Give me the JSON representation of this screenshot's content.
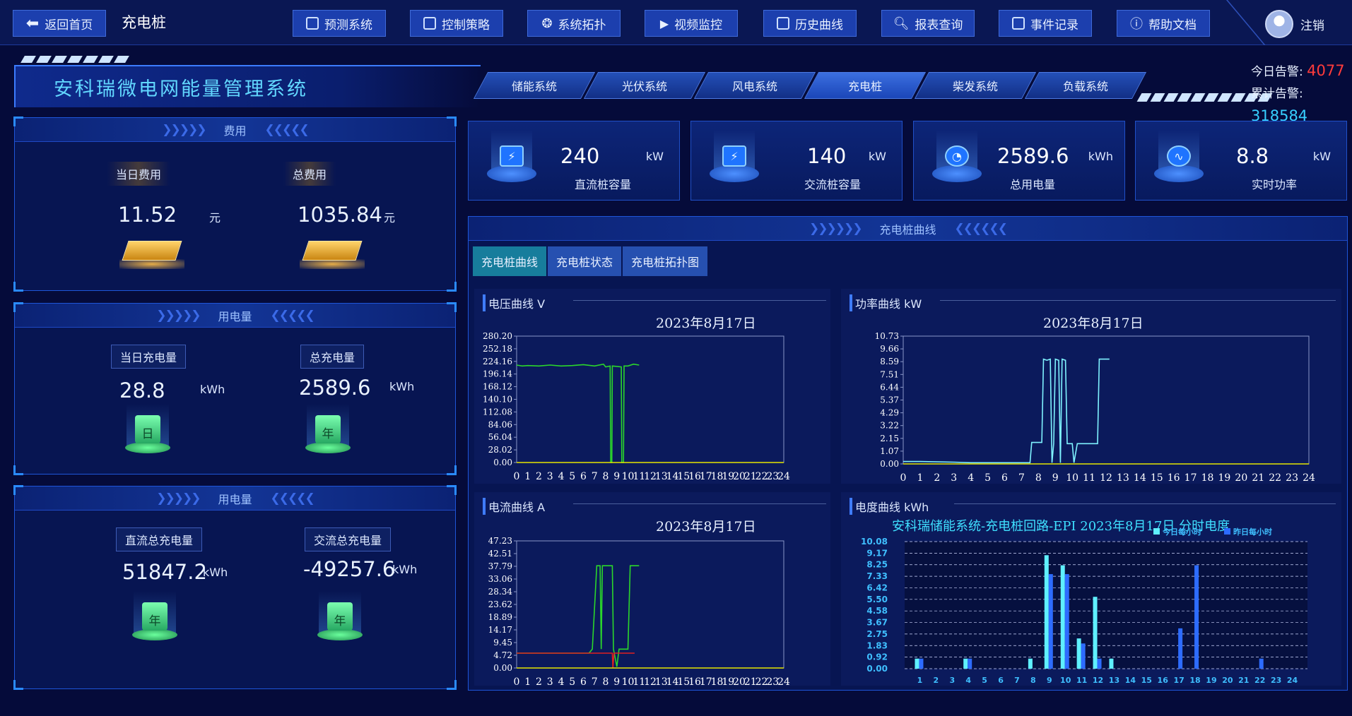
{
  "nav": {
    "back_label": "返回首页",
    "title": "充电桩",
    "buttons": [
      {
        "label": "预测系统",
        "icon": "forecast-icon"
      },
      {
        "label": "控制策略",
        "icon": "control-icon"
      },
      {
        "label": "系统拓扑",
        "icon": "topology-icon"
      },
      {
        "label": "视频监控",
        "icon": "video-icon"
      },
      {
        "label": "历史曲线",
        "icon": "history-chart-icon"
      },
      {
        "label": "报表查询",
        "icon": "report-search-icon"
      },
      {
        "label": "事件记录",
        "icon": "event-log-icon"
      },
      {
        "label": "帮助文档",
        "icon": "help-icon"
      }
    ],
    "logout_label": "注销"
  },
  "header": {
    "system_title": "安科瑞微电网能量管理系统",
    "subtabs": [
      "储能系统",
      "光伏系统",
      "风电系统",
      "充电桩",
      "柴发系统",
      "负载系统"
    ],
    "active_subtab": "充电桩",
    "alarm_today_label": "今日告警:",
    "alarm_today_value": "4077",
    "alarm_total_label": "累计告警:",
    "alarm_total_value": "318584"
  },
  "fee_panel": {
    "title": "费用",
    "today_label": "当日费用",
    "today_value": "11.52",
    "today_unit": "元",
    "total_label": "总费用",
    "total_value": "1035.84",
    "total_unit": "元"
  },
  "energy_panel_1": {
    "title": "用电量",
    "today_label": "当日充电量",
    "today_value": "28.8",
    "today_unit": "kWh",
    "today_icon_text": "日",
    "total_label": "总充电量",
    "total_value": "2589.6",
    "total_unit": "kWh",
    "total_icon_text": "年"
  },
  "energy_panel_2": {
    "title": "用电量",
    "dc_label": "直流总充电量",
    "dc_value": "51847.2",
    "dc_unit": "kWh",
    "dc_icon_text": "年",
    "ac_label": "交流总充电量",
    "ac_value": "-49257.6",
    "ac_unit": "kWh",
    "ac_icon_text": "年"
  },
  "kpis": [
    {
      "value": "240",
      "unit": "kW",
      "label": "直流桩容量",
      "icon": "dc-charger-icon"
    },
    {
      "value": "140",
      "unit": "kW",
      "label": "交流桩容量",
      "icon": "ac-charger-icon"
    },
    {
      "value": "2589.6",
      "unit": "kWh",
      "label": "总用电量",
      "icon": "meter-icon"
    },
    {
      "value": "8.8",
      "unit": "kW",
      "label": "实时功率",
      "icon": "pulse-icon"
    }
  ],
  "curve_panel": {
    "title": "充电桩曲线",
    "tabs": [
      "充电桩曲线",
      "充电桩状态",
      "充电桩拓扑图"
    ],
    "active_tab": "充电桩曲线"
  },
  "colors": {
    "green": "#2bd62b",
    "red": "#e02020",
    "cyan": "#7ff3ff",
    "yellow": "#e6e600",
    "bar_today": "#5ff0ff",
    "bar_yesterday": "#2d6cff"
  },
  "chart_data": [
    {
      "type": "line",
      "name": "voltage",
      "title": "电压曲线  V",
      "subtitle": "2023年8月17日",
      "x_ticks": [
        "0",
        "1",
        "2",
        "3",
        "4",
        "5",
        "6",
        "7",
        "8",
        "9",
        "10",
        "11",
        "12",
        "13",
        "14",
        "15",
        "16",
        "17",
        "18",
        "19",
        "20",
        "21",
        "22",
        "23",
        "24"
      ],
      "y_ticks": [
        "280.20",
        "252.18",
        "224.16",
        "196.14",
        "168.12",
        "140.10",
        "112.08",
        "84.06",
        "56.04",
        "28.02",
        "0.00"
      ],
      "ylim": [
        0,
        280.2
      ],
      "xlim": [
        0,
        24
      ],
      "series": [
        {
          "color": "#2bd62b",
          "points": [
            [
              0,
              216
            ],
            [
              0.5,
              214
            ],
            [
              1,
              215
            ],
            [
              2,
              214
            ],
            [
              3,
              216
            ],
            [
              4,
              214
            ],
            [
              5,
              215
            ],
            [
              6,
              217
            ],
            [
              7,
              214
            ],
            [
              7.8,
              218
            ],
            [
              8,
              212
            ],
            [
              8.4,
              214
            ],
            [
              8.45,
              0
            ],
            [
              8.55,
              0
            ],
            [
              8.6,
              214
            ],
            [
              9.4,
              212
            ],
            [
              9.45,
              0
            ],
            [
              9.6,
              0
            ],
            [
              9.65,
              214
            ],
            [
              10,
              214
            ],
            [
              10.5,
              218
            ],
            [
              11,
              216
            ]
          ]
        },
        {
          "color": "#e6e600",
          "points": [
            [
              0,
              0
            ],
            [
              24,
              0
            ]
          ]
        }
      ]
    },
    {
      "type": "line",
      "name": "power",
      "title": "功率曲线  kW",
      "subtitle": "2023年8月17日",
      "x_ticks": [
        "0",
        "1",
        "2",
        "3",
        "4",
        "5",
        "6",
        "7",
        "8",
        "9",
        "10",
        "11",
        "12",
        "13",
        "14",
        "15",
        "16",
        "17",
        "18",
        "19",
        "20",
        "21",
        "22",
        "23",
        "24"
      ],
      "y_ticks": [
        "10.73",
        "9.66",
        "8.59",
        "7.51",
        "6.44",
        "5.37",
        "4.29",
        "3.22",
        "2.15",
        "1.07",
        "0.00"
      ],
      "ylim": [
        0,
        10.73
      ],
      "xlim": [
        0,
        24
      ],
      "series": [
        {
          "color": "#7ff3ff",
          "points": [
            [
              0,
              0.2
            ],
            [
              1,
              0.2
            ],
            [
              3,
              0.15
            ],
            [
              4,
              0.1
            ],
            [
              6,
              0.1
            ],
            [
              7.5,
              0.1
            ],
            [
              7.6,
              1.8
            ],
            [
              8.2,
              1.8
            ],
            [
              8.3,
              8.8
            ],
            [
              8.5,
              8.7
            ],
            [
              8.7,
              8.8
            ],
            [
              8.8,
              0.1
            ],
            [
              8.9,
              1.7
            ],
            [
              9,
              8.8
            ],
            [
              9.2,
              8.7
            ],
            [
              9.3,
              0.1
            ],
            [
              9.4,
              8.8
            ],
            [
              9.6,
              8.7
            ],
            [
              9.7,
              1.7
            ],
            [
              10,
              1.7
            ],
            [
              10.1,
              0.1
            ],
            [
              10.3,
              1.7
            ],
            [
              11.5,
              1.7
            ],
            [
              11.6,
              8.8
            ],
            [
              12.2,
              8.8
            ]
          ]
        },
        {
          "color": "#e6e600",
          "points": [
            [
              0,
              0
            ],
            [
              24,
              0
            ]
          ]
        }
      ]
    },
    {
      "type": "line",
      "name": "current",
      "title": "电流曲线  A",
      "subtitle": "2023年8月17日",
      "x_ticks": [
        "0",
        "1",
        "2",
        "3",
        "4",
        "5",
        "6",
        "7",
        "8",
        "9",
        "10",
        "11",
        "12",
        "13",
        "14",
        "15",
        "16",
        "17",
        "18",
        "19",
        "20",
        "21",
        "22",
        "23",
        "24"
      ],
      "y_ticks": [
        "47.23",
        "42.51",
        "37.79",
        "33.06",
        "28.34",
        "23.62",
        "18.89",
        "14.17",
        "9.45",
        "4.72",
        "0.00"
      ],
      "ylim": [
        0,
        47.23
      ],
      "xlim": [
        0,
        24
      ],
      "series": [
        {
          "color": "#2bd62b",
          "points": [
            [
              0,
              5.5
            ],
            [
              6.5,
              5.5
            ],
            [
              6.8,
              7
            ],
            [
              7.2,
              38
            ],
            [
              7.5,
              38
            ],
            [
              7.6,
              7
            ],
            [
              7.7,
              38
            ],
            [
              8.6,
              38
            ],
            [
              8.7,
              7
            ],
            [
              9,
              0.5
            ],
            [
              9.2,
              7
            ],
            [
              10,
              7
            ],
            [
              10.2,
              38
            ],
            [
              11,
              38
            ]
          ]
        },
        {
          "color": "#e02020",
          "points": [
            [
              0,
              5.5
            ],
            [
              8.6,
              5.5
            ],
            [
              8.65,
              0
            ],
            [
              8.75,
              5.5
            ],
            [
              10.6,
              5.5
            ]
          ]
        },
        {
          "color": "#e6e600",
          "points": [
            [
              0,
              0
            ],
            [
              24,
              0
            ]
          ]
        }
      ]
    },
    {
      "type": "bar",
      "name": "energy",
      "title": "电度曲线  kWh",
      "subtitle": "安科瑞储能系统-充电桩回路-EPI  2023年8月17日  分时电度",
      "legend": [
        "今日每小时",
        "昨日每小时"
      ],
      "categories": [
        "1",
        "2",
        "3",
        "4",
        "5",
        "6",
        "7",
        "8",
        "9",
        "10",
        "11",
        "12",
        "13",
        "14",
        "15",
        "16",
        "17",
        "18",
        "19",
        "20",
        "21",
        "22",
        "23",
        "24"
      ],
      "y_ticks": [
        "10.08",
        "9.17",
        "8.25",
        "7.33",
        "6.42",
        "5.50",
        "4.58",
        "3.67",
        "2.75",
        "1.83",
        "0.92",
        "0.00"
      ],
      "ylim": [
        0,
        10.08
      ],
      "series": [
        {
          "name": "今日每小时",
          "color": "#5ff0ff",
          "values": [
            0.8,
            0,
            0,
            0.8,
            0,
            0,
            0,
            0.8,
            9.0,
            8.2,
            2.4,
            5.7,
            0.8,
            0,
            0,
            0,
            0,
            0,
            0,
            0,
            0,
            0,
            0,
            0
          ]
        },
        {
          "name": "昨日每小时",
          "color": "#2d6cff",
          "values": [
            0.8,
            0,
            0,
            0.8,
            0,
            0,
            0,
            0,
            7.5,
            7.5,
            2.0,
            0.8,
            0,
            0,
            0,
            0,
            3.2,
            8.2,
            0,
            0,
            0,
            0.8,
            0,
            0
          ]
        }
      ]
    }
  ]
}
